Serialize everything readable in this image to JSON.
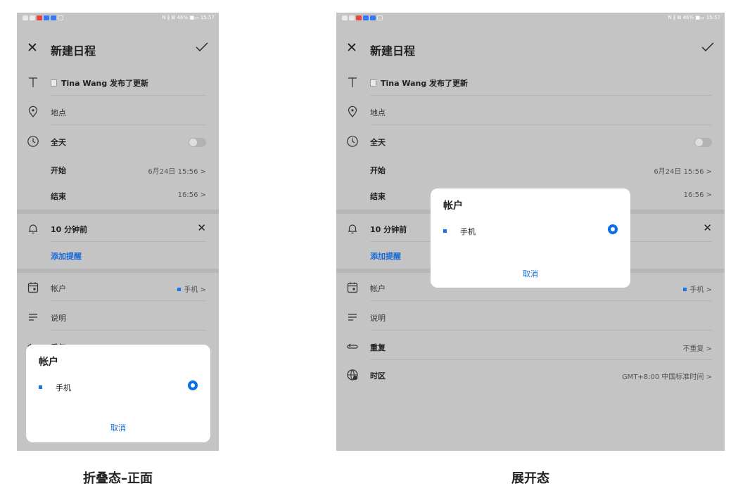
{
  "status": {
    "right_text": "N ∦ ⊠ 46% ■▭ 15:57"
  },
  "form": {
    "title": "新建日程",
    "name_value": "Tina Wang 发布了更新",
    "location_placeholder": "地点",
    "allday_label": "全天",
    "allday_on": false,
    "start_label": "开始",
    "start_value": "6月24日 15:56 >",
    "end_label": "结束",
    "end_value": "16:56 >",
    "reminder_value": "10 分钟前",
    "add_reminder_label": "添加提醒",
    "account_label": "帐户",
    "account_value": "手机 >",
    "desc_placeholder": "说明",
    "repeat_label": "重复",
    "repeat_value": "不重复 >",
    "timezone_label": "时区",
    "timezone_value": "GMT+8:00 中国标准时间 >"
  },
  "dialog": {
    "title": "帐户",
    "option_label": "手机",
    "option_selected": true,
    "cancel_label": "取消"
  },
  "captions": {
    "left": "折叠态–正面",
    "right": "展开态"
  },
  "colors": {
    "accent": "#1a73e8",
    "screen_bg": "#c4c4c4",
    "dialog_bg": "#ffffff"
  }
}
